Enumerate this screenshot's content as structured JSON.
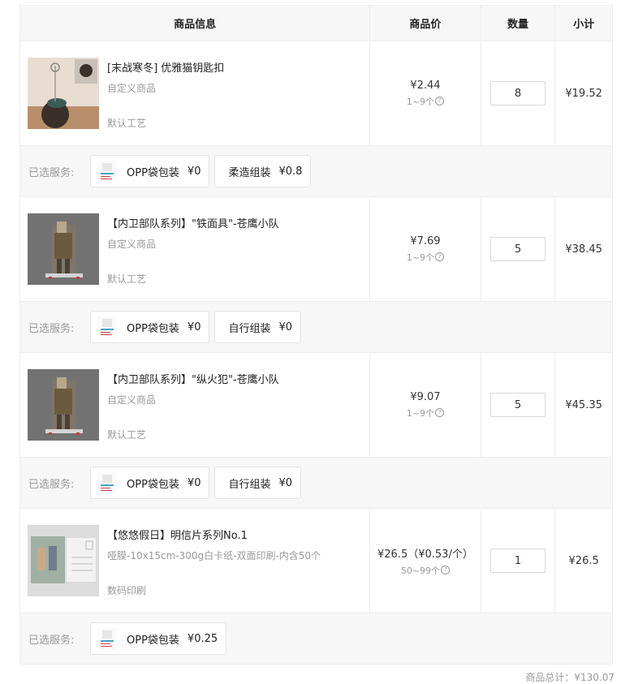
{
  "header": {
    "info": "商品信息",
    "price": "商品价",
    "qty": "数量",
    "subtotal": "小计"
  },
  "services_label": "已选服务:",
  "items": [
    {
      "name": "[末战寒冬] 优雅猫钥匙扣",
      "spec": "自定义商品",
      "craft": "默认工艺",
      "price": "¥2.44",
      "range": "1~9个",
      "qty": "8",
      "subtotal": "¥19.52",
      "thumb_icon": "keychain-photo",
      "services": [
        {
          "name": "OPP袋包装",
          "price": "¥0",
          "icon": "opp-bag-icon"
        },
        {
          "name": "柔造组装",
          "price": "¥0.8",
          "icon": ""
        }
      ]
    },
    {
      "name": "【内卫部队系列】\"铁面具\"-苍鹰小队",
      "spec": "自定义商品",
      "craft": "默认工艺",
      "price": "¥7.69",
      "range": "1~9个",
      "qty": "5",
      "subtotal": "¥38.45",
      "thumb_icon": "acrylic-standee-photo",
      "services": [
        {
          "name": "OPP袋包装",
          "price": "¥0",
          "icon": "opp-bag-icon"
        },
        {
          "name": "自行组装",
          "price": "¥0",
          "icon": ""
        }
      ]
    },
    {
      "name": "【内卫部队系列】\"纵火犯\"-苍鹰小队",
      "spec": "自定义商品",
      "craft": "默认工艺",
      "price": "¥9.07",
      "range": "1~9个",
      "qty": "5",
      "subtotal": "¥45.35",
      "thumb_icon": "acrylic-standee-photo",
      "services": [
        {
          "name": "OPP袋包装",
          "price": "¥0",
          "icon": "opp-bag-icon"
        },
        {
          "name": "自行组装",
          "price": "¥0",
          "icon": ""
        }
      ]
    },
    {
      "name": "【悠悠假日】明信片系列No.1",
      "spec": "哑膜-10x15cm-300g白卡纸-双面印刷-内含50个",
      "craft": "数码印刷",
      "price": "¥26.5（¥0.53/个）",
      "range": "50~99个",
      "qty": "1",
      "subtotal": "¥26.5",
      "thumb_icon": "postcard-photo",
      "services": [
        {
          "name": "OPP袋包装",
          "price": "¥0.25",
          "icon": "opp-bag-icon"
        }
      ]
    }
  ],
  "footer": {
    "total_label": "商品总计：¥130.07"
  }
}
